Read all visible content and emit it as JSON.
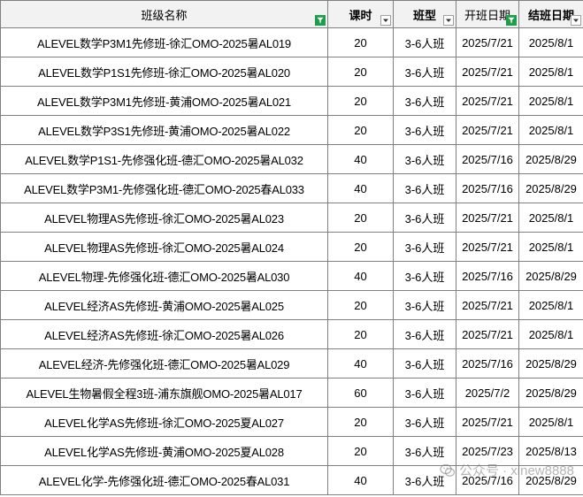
{
  "header": {
    "class_name": "班级名称",
    "hours": "课时",
    "class_type": "班型",
    "start_date": "开班日期",
    "end_date": "结班日期"
  },
  "rows": [
    {
      "name": "ALEVEL数学P3M1先修班-徐汇OMO-2025暑AL019",
      "hours": "20",
      "type": "3-6人班",
      "start": "2025/7/21",
      "end": "2025/8/1"
    },
    {
      "name": "ALEVEL数学P1S1先修班-徐汇OMO-2025暑AL020",
      "hours": "20",
      "type": "3-6人班",
      "start": "2025/7/21",
      "end": "2025/8/1"
    },
    {
      "name": "ALEVEL数学P3M1先修班-黄浦OMO-2025暑AL021",
      "hours": "20",
      "type": "3-6人班",
      "start": "2025/7/21",
      "end": "2025/8/1"
    },
    {
      "name": "ALEVEL数学P3S1先修班-黄浦OMO-2025暑AL022",
      "hours": "20",
      "type": "3-6人班",
      "start": "2025/7/21",
      "end": "2025/8/1"
    },
    {
      "name": "ALEVEL数学P1S1-先修强化班-德汇OMO-2025暑AL032",
      "hours": "40",
      "type": "3-6人班",
      "start": "2025/7/16",
      "end": "2025/8/29"
    },
    {
      "name": "ALEVEL数学P3M1-先修强化班-德汇OMO-2025春AL033",
      "hours": "40",
      "type": "3-6人班",
      "start": "2025/7/16",
      "end": "2025/8/29"
    },
    {
      "name": "ALEVEL物理AS先修班-徐汇OMO-2025暑AL023",
      "hours": "20",
      "type": "3-6人班",
      "start": "2025/7/21",
      "end": "2025/8/1"
    },
    {
      "name": "ALEVEL物理AS先修班-徐汇OMO-2025暑AL024",
      "hours": "20",
      "type": "3-6人班",
      "start": "2025/7/21",
      "end": "2025/8/1"
    },
    {
      "name": "ALEVEL物理-先修强化班-德汇OMO-2025暑AL030",
      "hours": "40",
      "type": "3-6人班",
      "start": "2025/7/16",
      "end": "2025/8/29"
    },
    {
      "name": "ALEVEL经济AS先修班-黄浦OMO-2025暑AL025",
      "hours": "20",
      "type": "3-6人班",
      "start": "2025/7/21",
      "end": "2025/8/1"
    },
    {
      "name": "ALEVEL经济AS先修班-徐汇OMO-2025暑AL026",
      "hours": "20",
      "type": "3-6人班",
      "start": "2025/7/21",
      "end": "2025/8/1"
    },
    {
      "name": "ALEVEL经济-先修强化班-德汇OMO-2025暑AL029",
      "hours": "40",
      "type": "3-6人班",
      "start": "2025/7/16",
      "end": "2025/8/29"
    },
    {
      "name": "ALEVEL生物暑假全程3班-浦东旗舰OMO-2025暑AL017",
      "hours": "60",
      "type": "3-6人班",
      "start": "2025/7/2",
      "end": "2025/8/29"
    },
    {
      "name": "ALEVEL化学AS先修班-徐汇OMO-2025夏AL027",
      "hours": "20",
      "type": "3-6人班",
      "start": "2025/7/21",
      "end": "2025/8/1"
    },
    {
      "name": "ALEVEL化学AS先修班-黄浦OMO-2025夏AL028",
      "hours": "20",
      "type": "3-6人班",
      "start": "2025/7/23",
      "end": "2025/8/13"
    },
    {
      "name": "ALEVEL化学-先修强化班-德汇OMO-2025春AL031",
      "hours": "40",
      "type": "3-6人班",
      "start": "2025/7/16",
      "end": "2025/8/29"
    }
  ],
  "watermark": {
    "text": "公众号 · xinew8888",
    "icon": "wechat-icon"
  },
  "colors": {
    "active_filter": "#1e9e4a",
    "header_bg": "#f2f2f2",
    "grid": "#808080"
  }
}
